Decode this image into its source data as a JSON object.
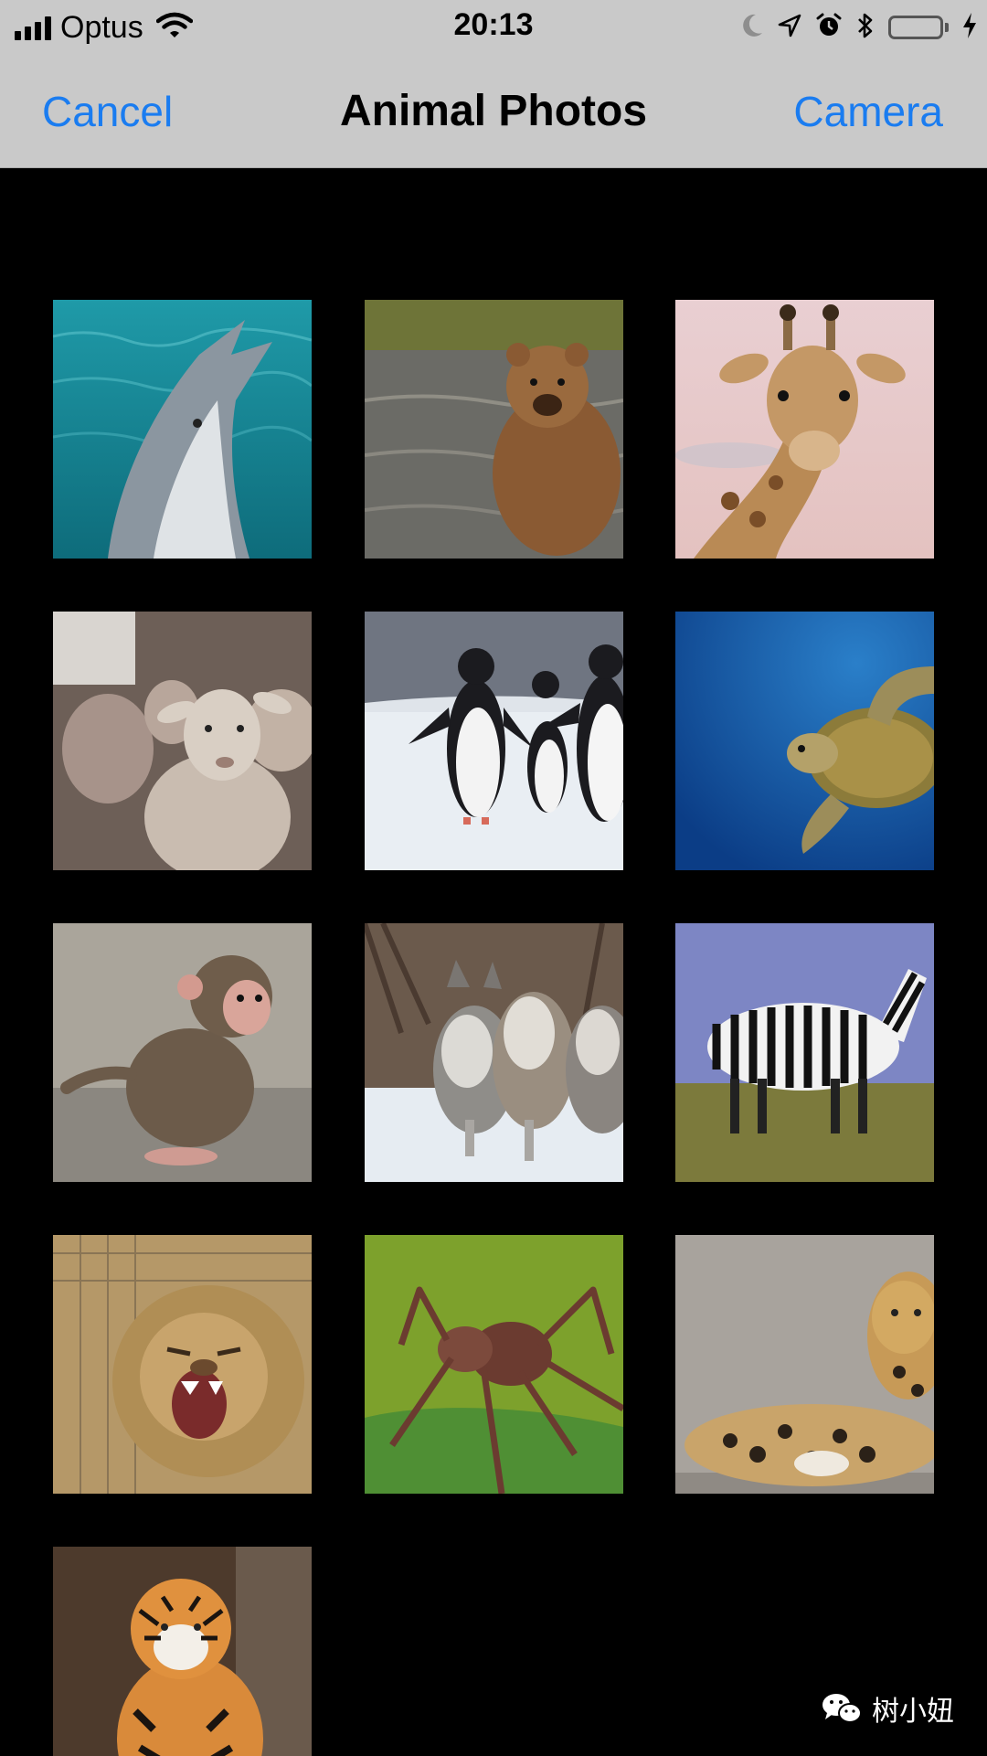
{
  "status_bar": {
    "carrier": "Optus",
    "time": "20:13",
    "icons": [
      "signal-icon",
      "wifi-icon",
      "moon-icon",
      "location-icon",
      "alarm-icon",
      "bluetooth-icon",
      "battery-icon",
      "charging-icon"
    ],
    "battery_color": "#4cd964"
  },
  "nav": {
    "cancel_label": "Cancel",
    "title": "Animal Photos",
    "camera_label": "Camera",
    "accent_color": "#1a7cf0"
  },
  "photos": [
    {
      "subject": "dolphin"
    },
    {
      "subject": "bear"
    },
    {
      "subject": "giraffe"
    },
    {
      "subject": "sheep"
    },
    {
      "subject": "penguins"
    },
    {
      "subject": "sea-turtle"
    },
    {
      "subject": "monkey"
    },
    {
      "subject": "wolves"
    },
    {
      "subject": "zebras"
    },
    {
      "subject": "lion"
    },
    {
      "subject": "spider"
    },
    {
      "subject": "leopard"
    },
    {
      "subject": "tiger"
    }
  ],
  "watermark": {
    "text": "树小妞",
    "icon": "wechat-icon"
  }
}
